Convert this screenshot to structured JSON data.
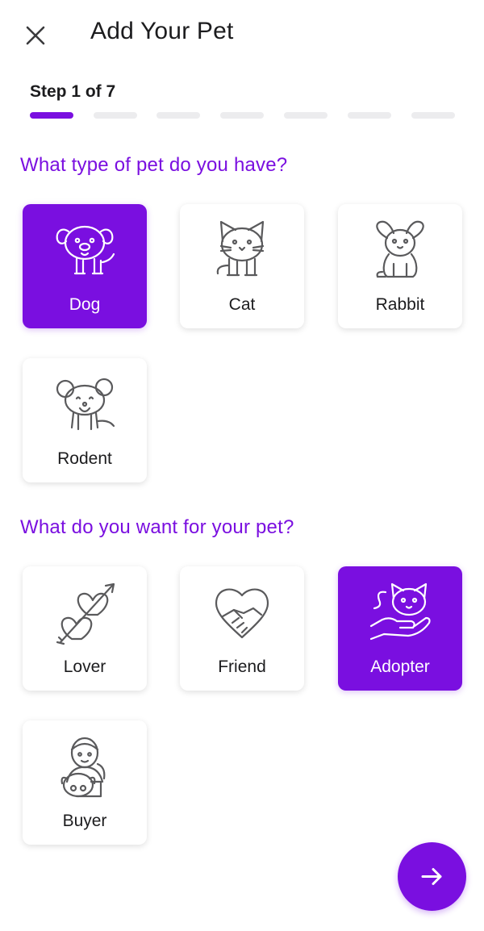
{
  "header": {
    "title": "Add Your Pet",
    "close_icon": "close-icon"
  },
  "progress": {
    "step_label": "Step 1 of 7",
    "current": 1,
    "total": 7
  },
  "sections": {
    "pet_type": {
      "title": "What type of pet do you have?",
      "options": [
        {
          "label": "Dog",
          "icon": "dog-icon",
          "selected": true
        },
        {
          "label": "Cat",
          "icon": "cat-icon",
          "selected": false
        },
        {
          "label": "Rabbit",
          "icon": "rabbit-icon",
          "selected": false
        },
        {
          "label": "Rodent",
          "icon": "rodent-icon",
          "selected": false
        }
      ]
    },
    "goal": {
      "title": "What do you want for your pet?",
      "options": [
        {
          "label": "Lover",
          "icon": "hearts-arrow-icon",
          "selected": false
        },
        {
          "label": "Friend",
          "icon": "handshake-heart-icon",
          "selected": false
        },
        {
          "label": "Adopter",
          "icon": "hand-holding-cat-icon",
          "selected": true
        },
        {
          "label": "Buyer",
          "icon": "person-with-pet-icon",
          "selected": false
        }
      ]
    }
  },
  "next_button": {
    "icon": "arrow-right-icon"
  },
  "colors": {
    "accent": "#7a0fe0",
    "track": "#ececee",
    "icon_stroke": "#5a5a5c"
  }
}
